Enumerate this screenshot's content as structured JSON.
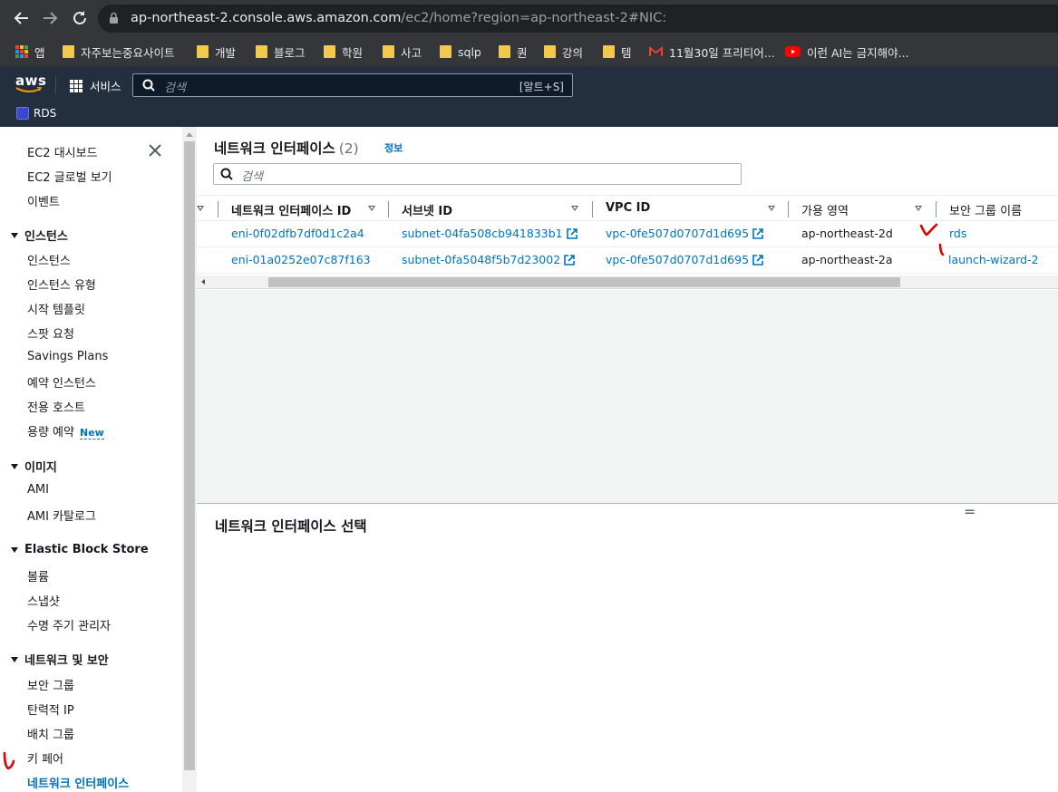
{
  "browser": {
    "url_host": "ap-northeast-2.console.aws.amazon.com",
    "url_path": "/ec2/home?region=ap-northeast-2#NIC:",
    "bookmarks": [
      {
        "icon": "apps-icon",
        "label": "앱"
      },
      {
        "icon": "folder-icon",
        "label": "자주보는중요사이트"
      },
      {
        "icon": "folder-icon",
        "label": "개발"
      },
      {
        "icon": "folder-icon",
        "label": "블로그"
      },
      {
        "icon": "folder-icon",
        "label": "학원"
      },
      {
        "icon": "folder-icon",
        "label": "사고"
      },
      {
        "icon": "folder-icon",
        "label": "sqlp"
      },
      {
        "icon": "folder-icon",
        "label": "퀀"
      },
      {
        "icon": "folder-icon",
        "label": "강의"
      },
      {
        "icon": "folder-icon",
        "label": "템"
      },
      {
        "icon": "gmail-icon",
        "label": "11월30일 프리티어..."
      },
      {
        "icon": "youtube-icon",
        "label": "이런 AI는 금지해야..."
      }
    ]
  },
  "aws": {
    "logo": "aws",
    "services_label": "서비스",
    "search_placeholder": "검색",
    "search_shortcut": "[알트+S]",
    "favorite": "RDS"
  },
  "sidebar": {
    "top_items": [
      "EC2 대시보드",
      "EC2 글로벌 보기",
      "이벤트"
    ],
    "sections": [
      {
        "title": "인스턴스",
        "items": [
          "인스턴스",
          "인스턴스 유형",
          "시작 템플릿",
          "스팟 요청",
          "Savings Plans",
          "예약 인스턴스",
          "전용 호스트",
          "용량 예약"
        ]
      },
      {
        "title": "이미지",
        "items": [
          "AMI",
          "AMI 카탈로그"
        ]
      },
      {
        "title": "Elastic Block Store",
        "items": [
          "볼륨",
          "스냅샷",
          "수명 주기 관리자"
        ]
      },
      {
        "title": "네트워크 및 보안",
        "items": [
          "보안 그룹",
          "탄력적 IP",
          "배치 그룹",
          "키 페어",
          "네트워크 인터페이스"
        ]
      }
    ],
    "new_badge": "New",
    "active_item": "네트워크 인터페이스"
  },
  "main": {
    "title": "네트워크 인터페이스",
    "count": "(2)",
    "info_link": "정보",
    "filter_placeholder": "검색",
    "columns": [
      "네트워크 인터페이스 ID",
      "서브넷 ID",
      "VPC ID",
      "가용 영역",
      "보안 그룹 이름"
    ],
    "rows": [
      {
        "eni": "eni-0f02dfb7df0d1c2a4",
        "subnet": "subnet-04fa508cb941833b1",
        "vpc": "vpc-0fe507d0707d1d695",
        "az": "ap-northeast-2d",
        "sg": "rds"
      },
      {
        "eni": "eni-01a0252e07c87f163",
        "subnet": "subnet-0fa5048f5b7d23002",
        "vpc": "vpc-0fe507d0707d1d695",
        "az": "ap-northeast-2a",
        "sg": "launch-wizard-2"
      }
    ],
    "detail_title": "네트워크 인터페이스 선택"
  },
  "colors": {
    "aws_header": "#232f3e",
    "link": "#0073bb",
    "annotation": "#e00000"
  }
}
